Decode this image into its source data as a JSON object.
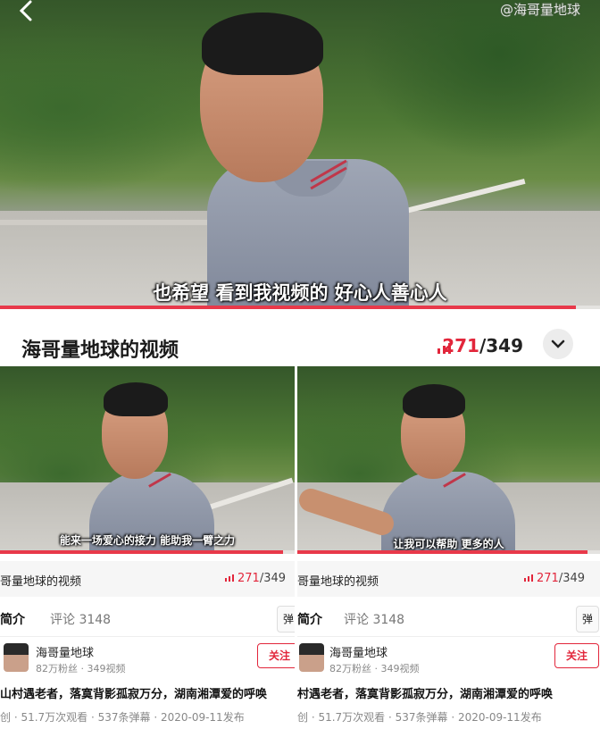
{
  "top_video": {
    "watermark": "@海哥量地球",
    "back_icon": "back-icon",
    "subtitle": "也希望  看到我视频的  好心人善心人",
    "progress": 0.96
  },
  "playlist": {
    "title": "海哥量地球的视频",
    "current": "271",
    "total": "/349",
    "icon": "bars-icon",
    "expand_icon": "chevron-down-icon"
  },
  "left_panel": {
    "subtitle": "能来一场爱心的接力  能助我一臂之力",
    "playlist_title": "哥量地球的视频",
    "playlist_current": "271",
    "playlist_total": "/349",
    "tab_intro": "简介",
    "tab_comments": "评论 3148",
    "danmu_label": "弹",
    "author_name": "海哥量地球",
    "author_meta": "82万粉丝 · 349视频",
    "follow_label": "关注",
    "video_title": "山村遇老者，落寞背影孤寂万分，湖南湘潭爱的呼唤",
    "video_stats": "创 · 51.7万次观看 · 537条弹幕 · 2020-09-11发布"
  },
  "right_panel": {
    "subtitle": "让我可以帮助  更多的人",
    "playlist_title": "哥量地球的视频",
    "playlist_current": "271",
    "playlist_total": "/349",
    "tab_intro": "简介",
    "tab_comments": "评论 3148",
    "danmu_label": "弹",
    "author_name": "海哥量地球",
    "author_meta": "82万粉丝 · 349视频",
    "follow_label": "关注",
    "video_title": "村遇老者，落寞背影孤寂万分，湖南湘潭爱的呼唤",
    "video_stats": "创 · 51.7万次观看 · 537条弹幕 · 2020-09-11发布"
  },
  "colors": {
    "accent": "#e2263b",
    "progress": "#e8394a"
  }
}
